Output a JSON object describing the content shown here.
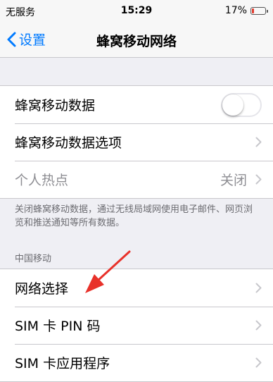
{
  "status_bar": {
    "carrier": "无服务",
    "time": "15:29",
    "battery_percent": "17%",
    "battery_level": 0.17,
    "battery_color": "#e23b2e"
  },
  "nav": {
    "back_label": "设置",
    "title": "蜂窝移动网络"
  },
  "group1": {
    "cellular_data_label": "蜂窝移动数据",
    "cellular_data_enabled": false,
    "cellular_options_label": "蜂窝移动数据选项",
    "hotspot_label": "个人热点",
    "hotspot_value": "关闭"
  },
  "footnote": "关闭蜂窝移动数据，通过无线局域网使用电子邮件、网页浏览和推送通知等所有数据。",
  "section2": {
    "header": "中国移动",
    "network_selection_label": "网络选择",
    "sim_pin_label": "SIM 卡 PIN 码",
    "sim_apps_label": "SIM 卡应用程序"
  },
  "colors": {
    "accent": "#007aff",
    "annotation_arrow": "#e8312a"
  }
}
